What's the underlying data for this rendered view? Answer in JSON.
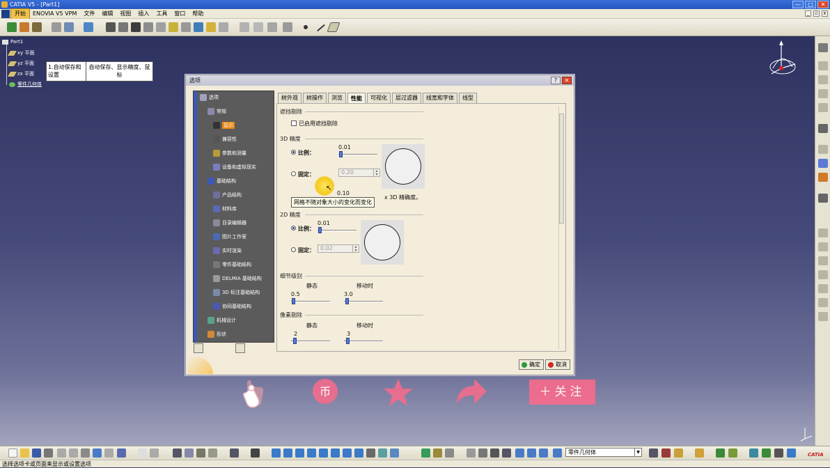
{
  "window": {
    "title": "CATIA V5 - [Part1]",
    "minimize": "—",
    "maximize": "□",
    "close": "✕"
  },
  "menu": {
    "items": [
      "开始",
      "ENOVIA V5 VPM",
      "文件",
      "编辑",
      "视图",
      "插入",
      "工具",
      "窗口",
      "帮助"
    ],
    "active": "开始"
  },
  "tree": {
    "root": "Part1",
    "items": [
      "xy 平面",
      "yz 平面",
      "zx 平面",
      "零件几何体"
    ]
  },
  "note": {
    "col1": "1.自动保存和设置",
    "col2": "自动保存、显示精度、鼠标"
  },
  "dialog": {
    "title": "选项",
    "help_btn": "?",
    "close_btn": "✕",
    "tree": {
      "root": "选项",
      "items": [
        "常规",
        "显示",
        "兼容性",
        "参数和测量",
        "设备和虚拟现实",
        "基础结构",
        "产品结构",
        "材料库",
        "目录编辑器",
        "图片工作室",
        "实时渲染",
        "零件基础结构",
        "DELMIA 基础结构",
        "3D 标注基础结构",
        "协同基础结构",
        "机械设计",
        "形状"
      ],
      "selected": "显示"
    },
    "tabs": [
      "树外观",
      "树操作",
      "浏览",
      "性能",
      "可视化",
      "层过滤器",
      "线宽和字体",
      "线型"
    ],
    "active_tab": "性能",
    "occlusion": {
      "title": "遮挡剔除",
      "checkbox": "已启用遮挡剔除",
      "checked": false
    },
    "precision3d": {
      "title": "3D 精度",
      "ratio_label": "比例：",
      "ratio_value": "0.01",
      "ratio_level": 0.02,
      "fixed_label": "固定：",
      "fixed_value": "0.20",
      "curve_value": "0.10",
      "curve_suffix": "x 3D 精确度。",
      "tooltip": "网格不随对象大小的变化而变化"
    },
    "precision2d": {
      "title": "2D 精度",
      "ratio_label": "比例：",
      "ratio_value": "0.01",
      "fixed_label": "固定：",
      "fixed_value": "0.02"
    },
    "lod": {
      "title": "细节级别",
      "static_label": "静态",
      "moving_label": "移动时",
      "static_value": "0.5",
      "moving_value": "3.0"
    },
    "pixel": {
      "title": "像素剔除",
      "static_label": "静态",
      "moving_label": "移动时",
      "static_value": "2",
      "moving_value": "3"
    },
    "ok_label": "确定",
    "cancel_label": "取消"
  },
  "overlay": {
    "follow": "＋关注"
  },
  "bottom": {
    "select_value": "零件几何体"
  },
  "status": {
    "text": "选择选项卡或页面来显示或设置选项"
  },
  "colors": {
    "accent_orange": "#e98a1a",
    "follow_pink": "#f26c8c",
    "title_blue": "#2456c0"
  }
}
